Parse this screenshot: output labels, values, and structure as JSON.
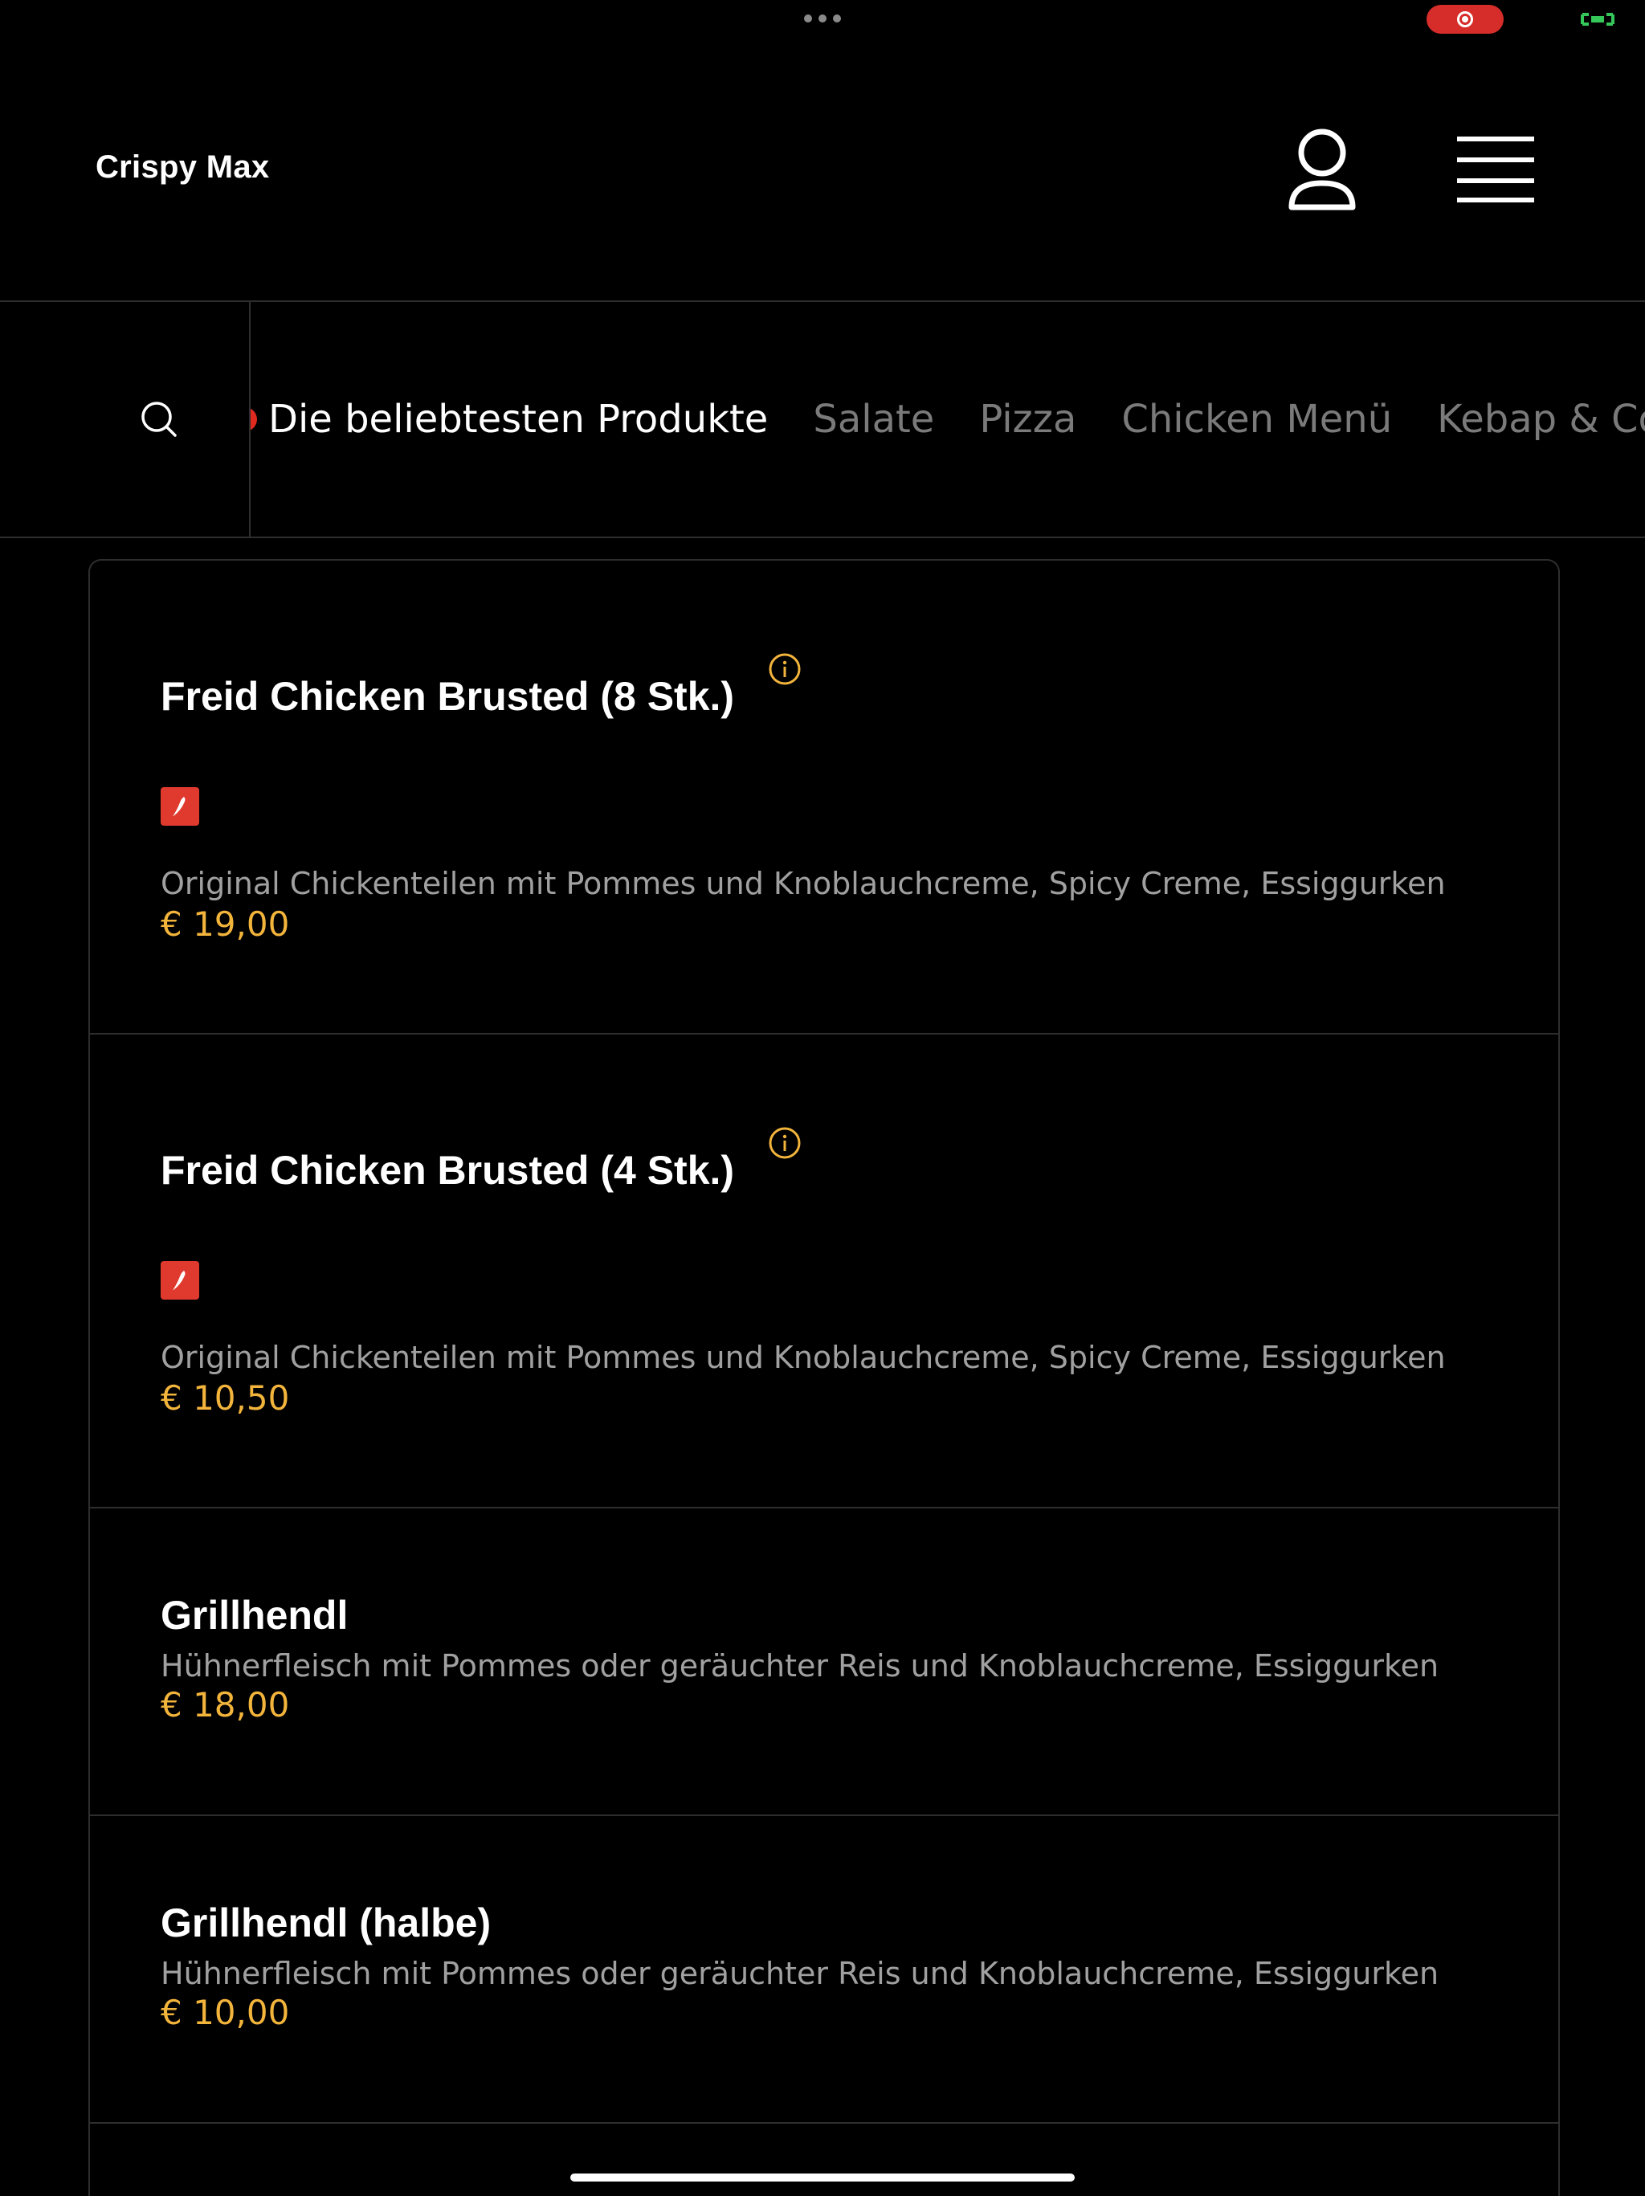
{
  "header": {
    "brand": "Crispy Max",
    "account_icon": "user-icon",
    "menu_icon": "hamburger-menu-icon"
  },
  "nav": {
    "search_icon": "search-icon",
    "tabs": [
      {
        "label": "Die beliebtesten Produkte",
        "active": true
      },
      {
        "label": "Salate",
        "active": false
      },
      {
        "label": "Pizza",
        "active": false
      },
      {
        "label": "Chicken Menü",
        "active": false
      },
      {
        "label": "Kebap & Co. M",
        "active": false
      }
    ]
  },
  "products": [
    {
      "title": "Freid Chicken Brusted (8 Stk.)",
      "description": "Original Chickenteilen mit Pommes und Knoblauchcreme, Spicy Creme, Essiggurken",
      "price": "€ 19,00"
    },
    {
      "title": "Freid Chicken Brusted (4 Stk.)",
      "description": "Original Chickenteilen mit Pommes und Knoblauchcreme, Spicy Creme, Essiggurken",
      "price": "€ 10,50"
    },
    {
      "title": "Grillhendl",
      "description": "Hühnerfleisch mit Pommes oder geräuchter Reis und Knoblauchcreme, Essiggurken",
      "price": "€ 18,00"
    },
    {
      "title": "Grillhendl (halbe)",
      "description": "Hühnerfleisch mit Pommes oder geräuchter Reis und Knoblauchcreme, Essiggurken",
      "price": "€ 10,00"
    }
  ],
  "colors": {
    "background": "#000000",
    "price": "#f3b43c",
    "accent_red": "#e03a2f",
    "muted_text": "#a0a0a0"
  }
}
